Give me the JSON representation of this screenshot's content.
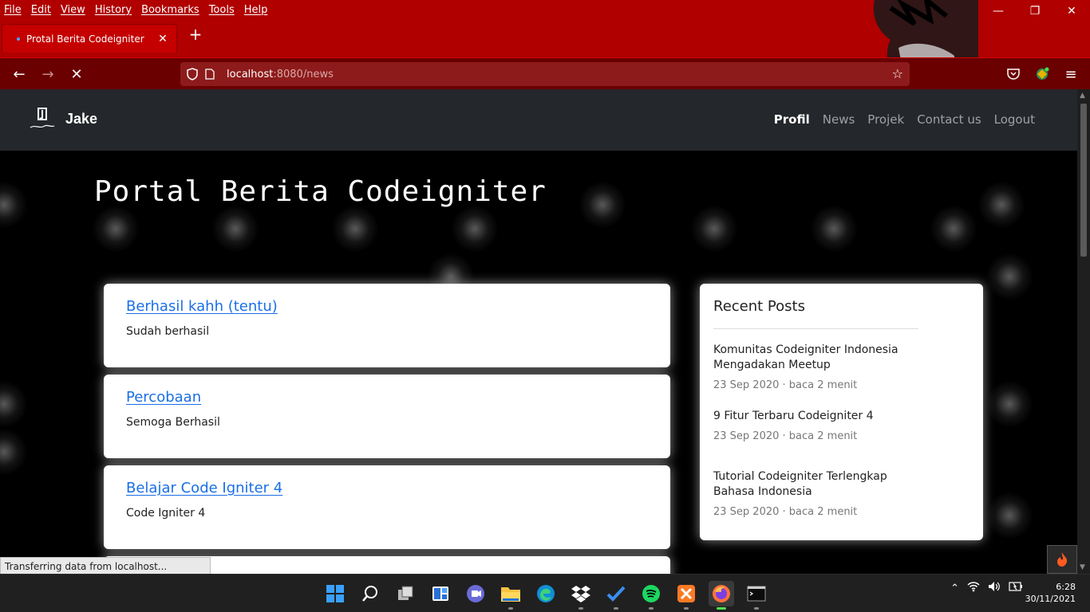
{
  "browser": {
    "menu": [
      "File",
      "Edit",
      "View",
      "History",
      "Bookmarks",
      "Tools",
      "Help"
    ],
    "tab_title": "Protal Berita Codeigniter",
    "url_host": "localhost",
    "url_rest": ":8080/news",
    "status_text": "Transferring data from localhost..."
  },
  "site": {
    "brand": "Jake",
    "nav": [
      {
        "label": "Profil",
        "active": true
      },
      {
        "label": "News",
        "active": false
      },
      {
        "label": "Projek",
        "active": false
      },
      {
        "label": "Contact us",
        "active": false
      },
      {
        "label": "Logout",
        "active": false
      }
    ],
    "hero_title": "Portal Berita Codeigniter",
    "news": [
      {
        "title": "Berhasil kahh (tentu)",
        "body": "Sudah berhasil"
      },
      {
        "title": "Percobaan",
        "body": "Semoga Berhasil"
      },
      {
        "title": "Belajar Code Igniter 4",
        "body": "Code Igniter 4"
      }
    ],
    "sidebar": {
      "heading": "Recent Posts",
      "posts": [
        {
          "title": "Komunitas Codeigniter Indonesia Mengadakan Meetup",
          "meta": "23 Sep 2020 · baca 2 menit"
        },
        {
          "title": "9 Fitur Terbaru Codeigniter 4",
          "meta": "23 Sep 2020 · baca 2 menit"
        },
        {
          "title": "Tutorial Codeigniter Terlengkap Bahasa Indonesia",
          "meta": "23 Sep 2020 · baca 2 menit"
        }
      ]
    }
  },
  "taskbar": {
    "time": "6:28",
    "date": "30/11/2021"
  },
  "colors": {
    "chrome_red": "#b00000",
    "link_blue": "#1a6fe6",
    "site_nav": "#24272b"
  }
}
